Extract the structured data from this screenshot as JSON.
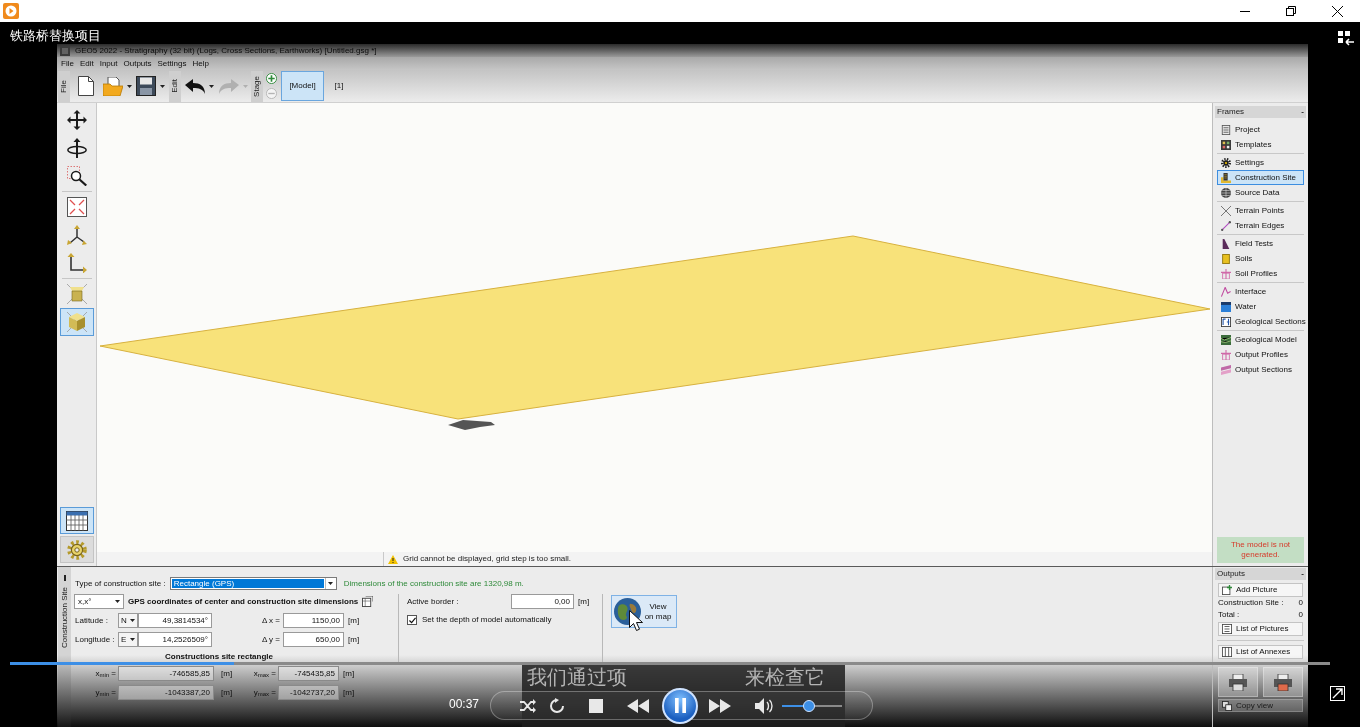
{
  "player": {
    "title": "铁路桥替换项目",
    "time": "00:37",
    "playing": true,
    "progress": {
      "level": 0.17
    },
    "volume": {
      "level": 0.45
    },
    "subtitle": [
      "我们通过项",
      "来检查它"
    ]
  },
  "window": {
    "title": "GEO5 2022 - Stratigraphy (32 bit) (Logs, Cross Sections, Earthworks) [Untitled.gsg *]"
  },
  "menu": [
    "File",
    "Edit",
    "Input",
    "Outputs",
    "Settings",
    "Help"
  ],
  "toolbar": {
    "sections": [
      "File",
      "Edit",
      "Stage"
    ],
    "redo": {
      "disabled": true
    },
    "remove_stage": {
      "disabled": true
    },
    "stages": [
      {
        "label": "[Model]",
        "selected": true
      },
      {
        "label": "[1]",
        "selected": false
      }
    ]
  },
  "tools": [
    {
      "selected": false
    },
    {
      "selected": false
    },
    {
      "selected": false
    },
    {
      "selected": false
    },
    {
      "selected": false
    },
    {
      "selected": false
    },
    {
      "selected": false
    },
    {
      "selected": true
    }
  ],
  "side_buttons": [
    {
      "selected": true
    },
    {
      "selected": false
    }
  ],
  "canvas": {
    "status": "Grid cannot be displayed, grid step is too small."
  },
  "frames": {
    "title": "Frames",
    "collapse": "-",
    "groups": [
      {
        "items": [
          {
            "label": "Project",
            "selected": false
          },
          {
            "label": "Templates",
            "selected": false
          }
        ]
      },
      {
        "items": [
          {
            "label": "Settings",
            "selected": false
          },
          {
            "label": "Construction Site",
            "selected": true
          },
          {
            "label": "Source Data",
            "selected": false
          }
        ]
      },
      {
        "items": [
          {
            "label": "Terrain Points",
            "selected": false
          },
          {
            "label": "Terrain Edges",
            "selected": false
          }
        ]
      },
      {
        "items": [
          {
            "label": "Field Tests",
            "selected": false
          },
          {
            "label": "Soils",
            "selected": false
          },
          {
            "label": "Soil Profiles",
            "selected": false
          }
        ]
      },
      {
        "items": [
          {
            "label": "Interface",
            "selected": false
          },
          {
            "label": "Water",
            "selected": false
          },
          {
            "label": "Geological Sections",
            "selected": false
          }
        ]
      },
      {
        "items": [
          {
            "label": "Geological Model",
            "selected": false
          },
          {
            "label": "Output Profiles",
            "selected": false
          },
          {
            "label": "Output Sections",
            "selected": false
          }
        ]
      }
    ],
    "status": "The model is not generated."
  },
  "construction_site": {
    "tab": "Construction Site",
    "type_label": "Type of construction site :",
    "type_value": "Rectangle (GPS)",
    "dimensions_note": "Dimensions of the construction site are 1320,98 m.",
    "format": "x,x°",
    "gps_heading": "GPS coordinates of center and construction site dimensions",
    "coordinates": [
      {
        "label": "Latitude :",
        "hemisphere": "N",
        "value": "49,3814534°",
        "delta_label": "Δ x =",
        "delta_value": "1150,00",
        "unit": "[m]"
      },
      {
        "label": "Longitude :",
        "hemisphere": "E",
        "value": "14,2526509°",
        "delta_label": "Δ y =",
        "delta_value": "650,00",
        "unit": "[m]"
      }
    ],
    "rectangle_heading": "Constructions site rectangle",
    "bounds": [
      {
        "label": "x$_{min}$ =",
        "value": "-746585,85",
        "unit": "[m]"
      },
      {
        "label": "x$_{max}$ =",
        "value": "-745435,85",
        "unit": "[m]"
      },
      {
        "label": "y$_{min}$ =",
        "value": "-1043387,20",
        "unit": "[m]"
      },
      {
        "label": "y$_{max}$ =",
        "value": "-1042737,20",
        "unit": "[m]"
      }
    ],
    "active_border": {
      "label": "Active border :",
      "value": "0,00",
      "unit": "[m]"
    },
    "auto_depth": {
      "label": "Set the depth of model automatically",
      "checked": true
    },
    "map_button": "View on map"
  },
  "outputs": {
    "title": "Outputs",
    "collapse": "-",
    "add_picture": "Add Picture",
    "counts": [
      {
        "label": "Construction Site :",
        "value": "0"
      },
      {
        "label": "Total :",
        "value": "0"
      }
    ],
    "list_pictures": "List of Pictures",
    "list_annexes": "List of Annexes",
    "copy_view": "Copy view"
  }
}
